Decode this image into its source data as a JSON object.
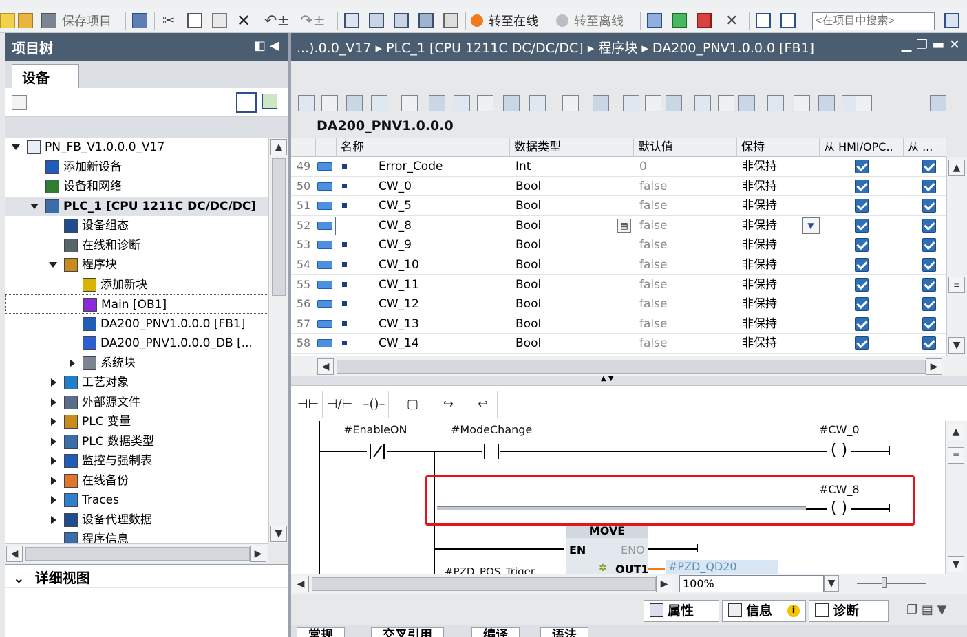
{
  "toolbar": {
    "save_label": "保存项目",
    "go_online": "转至在线",
    "go_offline": "转至离线",
    "search_placeholder": "<在项目中搜索>"
  },
  "project_tree": {
    "title": "项目树",
    "tab": "设备",
    "items": [
      {
        "label": "PN_FB_V1.0.0.0_V17",
        "indent": 0,
        "expand": "down"
      },
      {
        "label": "添加新设备",
        "indent": 1,
        "expand": ""
      },
      {
        "label": "设备和网络",
        "indent": 1,
        "expand": ""
      },
      {
        "label": "PLC_1 [CPU 1211C DC/DC/DC]",
        "indent": 1,
        "expand": "down"
      },
      {
        "label": "设备组态",
        "indent": 2,
        "expand": ""
      },
      {
        "label": "在线和诊断",
        "indent": 2,
        "expand": ""
      },
      {
        "label": "程序块",
        "indent": 2,
        "expand": "down"
      },
      {
        "label": "添加新块",
        "indent": 3,
        "expand": ""
      },
      {
        "label": "Main [OB1]",
        "indent": 3,
        "expand": ""
      },
      {
        "label": "DA200_PNV1.0.0.0 [FB1]",
        "indent": 3,
        "expand": ""
      },
      {
        "label": "DA200_PNV1.0.0.0_DB [...",
        "indent": 3,
        "expand": ""
      },
      {
        "label": "系统块",
        "indent": 3,
        "expand": "right"
      },
      {
        "label": "工艺对象",
        "indent": 2,
        "expand": "right"
      },
      {
        "label": "外部源文件",
        "indent": 2,
        "expand": "right"
      },
      {
        "label": "PLC 变量",
        "indent": 2,
        "expand": "right"
      },
      {
        "label": "PLC 数据类型",
        "indent": 2,
        "expand": "right"
      },
      {
        "label": "监控与强制表",
        "indent": 2,
        "expand": "right"
      },
      {
        "label": "在线备份",
        "indent": 2,
        "expand": "right"
      },
      {
        "label": "Traces",
        "indent": 2,
        "expand": "right"
      },
      {
        "label": "设备代理数据",
        "indent": 2,
        "expand": "right"
      },
      {
        "label": "程序信息",
        "indent": 2,
        "expand": ""
      }
    ],
    "detail_view": "详细视图"
  },
  "editor": {
    "breadcrumb": "...).0.0_V17 ▸ PLC_1 [CPU 1211C DC/DC/DC] ▸ 程序块 ▸ DA200_PNV1.0.0.0 [FB1]",
    "block_title": "DA200_PNV1.0.0.0",
    "columns": [
      "名称",
      "数据类型",
      "默认值",
      "保持",
      "从 HMI/OPC..",
      "从 ..."
    ],
    "rows": [
      {
        "no": "49",
        "name": "Error_Code",
        "type": "Int",
        "default": "0",
        "retain": "非保持"
      },
      {
        "no": "50",
        "name": "CW_0",
        "type": "Bool",
        "default": "false",
        "retain": "非保持"
      },
      {
        "no": "51",
        "name": "CW_5",
        "type": "Bool",
        "default": "false",
        "retain": "非保持"
      },
      {
        "no": "52",
        "name": "CW_8",
        "type": "Bool",
        "default": "false",
        "retain": "非保持"
      },
      {
        "no": "53",
        "name": "CW_9",
        "type": "Bool",
        "default": "false",
        "retain": "非保持"
      },
      {
        "no": "54",
        "name": "CW_10",
        "type": "Bool",
        "default": "false",
        "retain": "非保持"
      },
      {
        "no": "55",
        "name": "CW_11",
        "type": "Bool",
        "default": "false",
        "retain": "非保持"
      },
      {
        "no": "56",
        "name": "CW_12",
        "type": "Bool",
        "default": "false",
        "retain": "非保持"
      },
      {
        "no": "57",
        "name": "CW_13",
        "type": "Bool",
        "default": "false",
        "retain": "非保持"
      },
      {
        "no": "58",
        "name": "CW_14",
        "type": "Bool",
        "default": "false",
        "retain": "非保持"
      }
    ]
  },
  "ladder": {
    "contact1": "#EnableON",
    "contact2": "#ModeChange",
    "coil1": "#CW_0",
    "coil2": "#CW_8",
    "move_title": "MOVE",
    "en": "EN",
    "eno": "ENO",
    "out1": "OUT1",
    "out1_var": "#PZD_QD20",
    "in_var": "#PZD_POS_Triger",
    "zoom": "100%"
  },
  "inspector": {
    "properties": "属性",
    "info": "信息",
    "diagnostics": "诊断",
    "tabs": [
      "常规",
      "交叉引用",
      "编译",
      "语法"
    ]
  }
}
